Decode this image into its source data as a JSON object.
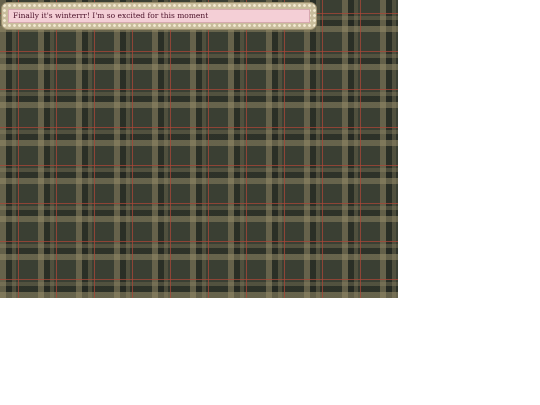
{
  "background": {
    "pattern": "plaid-tartan",
    "colors": {
      "base": "#3a3f33",
      "band": "#968c69",
      "accent": "#aa4637"
    }
  },
  "status_box": {
    "message": "Finally it's winterrr! I'm so excited for this moment",
    "frame_style": "lace",
    "fill_color": "#f4cfd6",
    "text_color": "#4a1028"
  }
}
